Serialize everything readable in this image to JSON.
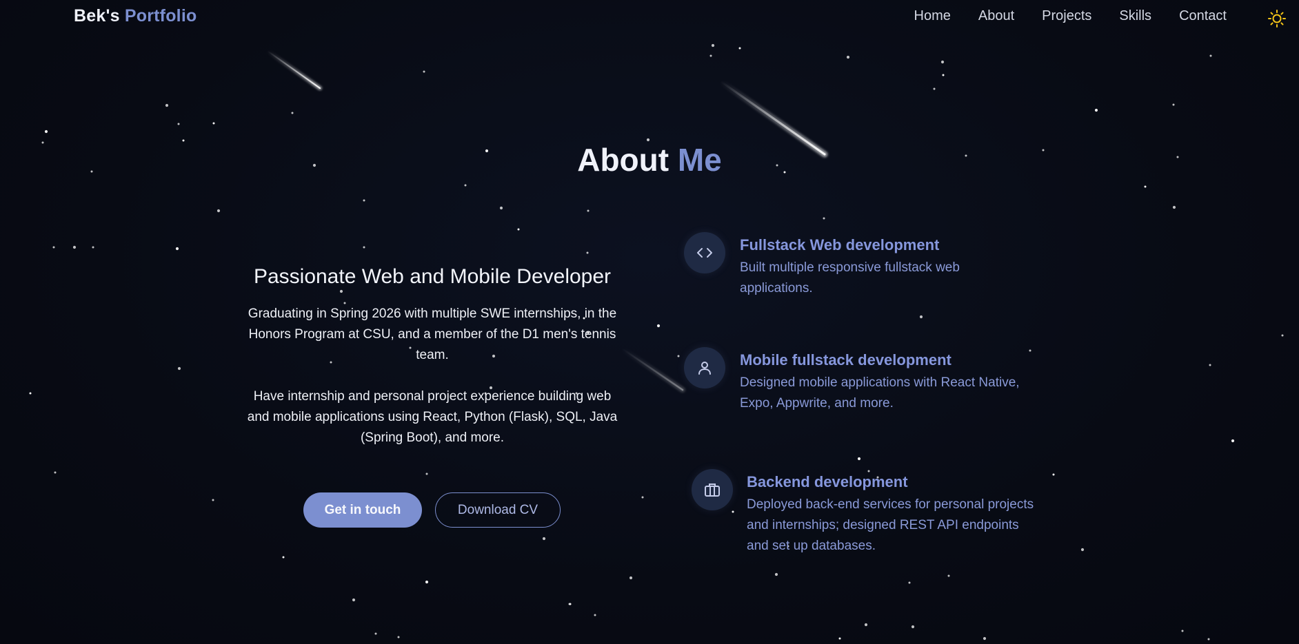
{
  "nav": {
    "logo_part1": "Bek's",
    "logo_part2": "Portfolio",
    "links": [
      "Home",
      "About",
      "Projects",
      "Skills",
      "Contact"
    ],
    "theme_toggle_icon": "sun-icon"
  },
  "about": {
    "title_part1": "About",
    "title_part2": "Me",
    "headline": "Passionate Web and Mobile Developer",
    "paragraph1": "Graduating in Spring 2026 with multiple SWE internships, in the Honors Program at CSU, and a member of the D1 men's tennis team.",
    "paragraph2": "Have internship and personal project experience building web and mobile applications using React, Python (Flask), SQL, Java (Spring Boot), and more.",
    "primary_button": "Get in touch",
    "secondary_button": "Download CV"
  },
  "skills": [
    {
      "icon": "code-icon",
      "title": "Fullstack Web development",
      "description": "Built multiple responsive fullstack web applications."
    },
    {
      "icon": "user-icon",
      "title": "Mobile fullstack development",
      "description": "Designed mobile applications with React Native, Expo, Appwrite, and more."
    },
    {
      "icon": "briefcase-icon",
      "title": "Backend development",
      "description": "Deployed back-end services for personal projects and internships; designed REST API endpoints and set up databases."
    }
  ],
  "colors": {
    "background": "#080b14",
    "accent": "#7c8fd0",
    "icon_circle": "#1f2a44",
    "sun": "#f5c518"
  }
}
